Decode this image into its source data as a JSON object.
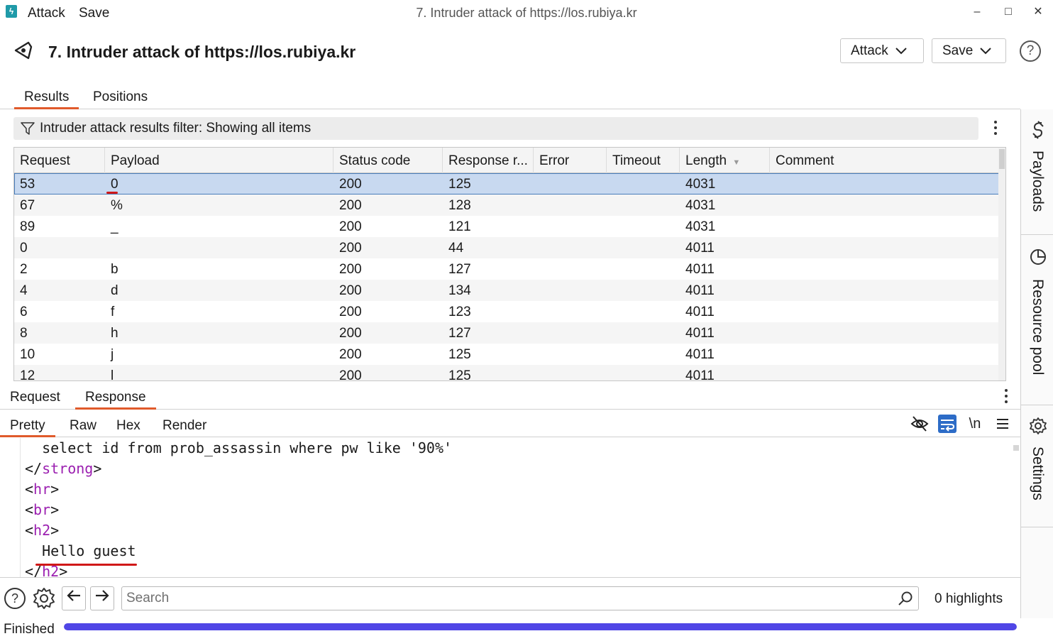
{
  "titlebar": {
    "menu": [
      "Attack",
      "Save"
    ],
    "window_title": "7. Intruder attack of https://los.rubiya.kr",
    "minimize": "–",
    "maximize": "□",
    "close": "✕"
  },
  "header": {
    "title": "7. Intruder attack of https://los.rubiya.kr",
    "attack_button": "Attack",
    "save_button": "Save",
    "help": "?"
  },
  "main_tabs": [
    "Results",
    "Positions"
  ],
  "filter": {
    "text": "Intruder attack results filter: Showing all items"
  },
  "table": {
    "columns": [
      "Request",
      "Payload",
      "Status code",
      "Response r...",
      "Error",
      "Timeout",
      "Length",
      "Comment"
    ],
    "rows": [
      {
        "request": "53",
        "payload": "0",
        "status": "200",
        "response": "125",
        "error": "",
        "timeout": "",
        "length": "4031",
        "comment": ""
      },
      {
        "request": "67",
        "payload": "%",
        "status": "200",
        "response": "128",
        "error": "",
        "timeout": "",
        "length": "4031",
        "comment": ""
      },
      {
        "request": "89",
        "payload": "_",
        "status": "200",
        "response": "121",
        "error": "",
        "timeout": "",
        "length": "4031",
        "comment": ""
      },
      {
        "request": "0",
        "payload": "",
        "status": "200",
        "response": "44",
        "error": "",
        "timeout": "",
        "length": "4011",
        "comment": ""
      },
      {
        "request": "2",
        "payload": "b",
        "status": "200",
        "response": "127",
        "error": "",
        "timeout": "",
        "length": "4011",
        "comment": ""
      },
      {
        "request": "4",
        "payload": "d",
        "status": "200",
        "response": "134",
        "error": "",
        "timeout": "",
        "length": "4011",
        "comment": ""
      },
      {
        "request": "6",
        "payload": "f",
        "status": "200",
        "response": "123",
        "error": "",
        "timeout": "",
        "length": "4011",
        "comment": ""
      },
      {
        "request": "8",
        "payload": "h",
        "status": "200",
        "response": "127",
        "error": "",
        "timeout": "",
        "length": "4011",
        "comment": ""
      },
      {
        "request": "10",
        "payload": "j",
        "status": "200",
        "response": "125",
        "error": "",
        "timeout": "",
        "length": "4011",
        "comment": ""
      },
      {
        "request": "12",
        "payload": "l",
        "status": "200",
        "response": "125",
        "error": "",
        "timeout": "",
        "length": "4011",
        "comment": ""
      }
    ]
  },
  "rr_tabs": [
    "Request",
    "Response"
  ],
  "view_tabs": [
    "Pretty",
    "Raw",
    "Hex",
    "Render"
  ],
  "toolbar_icons": {
    "newline": "\\n"
  },
  "code": {
    "line1": "  select id from prob_assassin where pw like '90%'",
    "line2_open": "</",
    "line2_tag": "strong",
    "line2_close": ">",
    "line3_tag": "hr",
    "line4_tag": "br",
    "line5_tag": "h2",
    "line6": "  Hello guest",
    "line7_tag": "h2"
  },
  "search": {
    "placeholder": "Search",
    "highlights": "0 highlights"
  },
  "status": {
    "text": "Finished",
    "progress": 1.0
  },
  "sidebar": {
    "items": [
      "Payloads",
      "Resource pool",
      "Settings"
    ]
  },
  "colors": {
    "accent_tab": "#e05a2b",
    "selection": "#c8d9f0",
    "progress": "#5046e6",
    "tag": "#9b1fb0",
    "annotation": "#d01818"
  }
}
